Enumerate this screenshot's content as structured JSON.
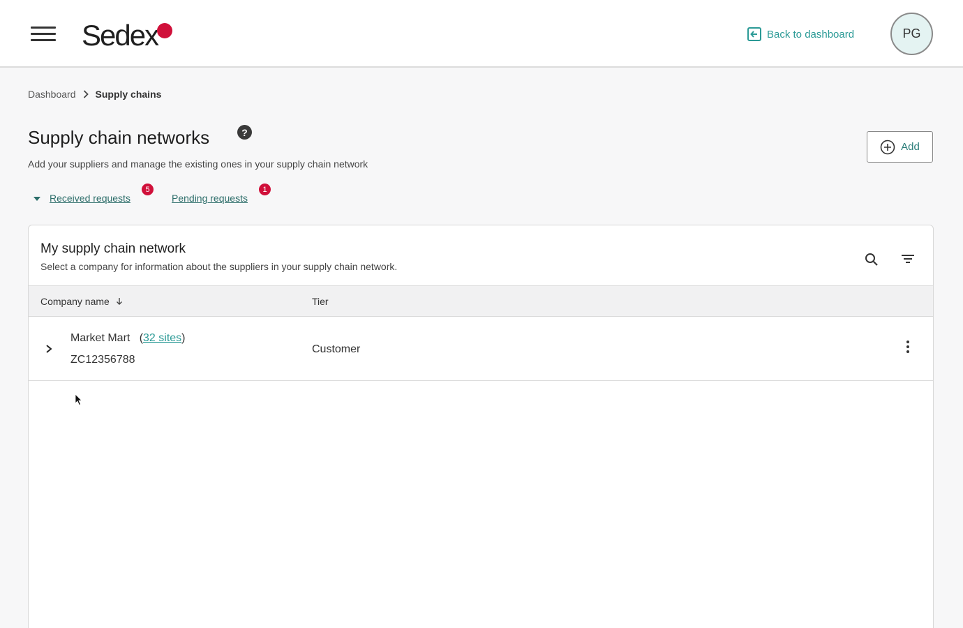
{
  "header": {
    "logo_text": "Sedex",
    "back_link": "Back to dashboard",
    "avatar_initials": "PG",
    "accent_color": "#2b9a96",
    "brand_red": "#d0103a"
  },
  "breadcrumb": {
    "items": [
      "Dashboard",
      "Supply chains"
    ]
  },
  "page": {
    "title": "Supply chain networks",
    "help_icon_glyph": "?",
    "subtitle": "Add your suppliers and manage the existing ones in your supply chain network",
    "add_button": "Add"
  },
  "requests": {
    "received_label": "Received requests",
    "received_count": "5",
    "pending_label": "Pending requests",
    "pending_count": "1"
  },
  "network_card": {
    "title": "My supply chain network",
    "subtitle": "Select a company for information about the suppliers in your supply chain network.",
    "columns": [
      "Company name",
      "Tier"
    ],
    "rows": [
      {
        "company": "Market Mart",
        "sites": "32 sites",
        "company_id": "ZC12356788",
        "tier": "Customer"
      }
    ]
  }
}
